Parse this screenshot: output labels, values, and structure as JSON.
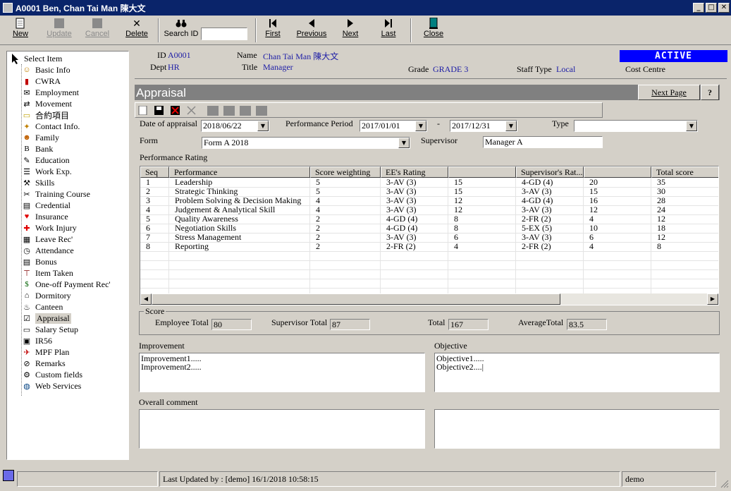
{
  "window": {
    "title": "A0001 Ben, Chan Tai Man 陳大文"
  },
  "toolbar": {
    "new": "New",
    "update": "Update",
    "cancel": "Cancel",
    "delete": "Delete",
    "search_id": "Search ID",
    "first": "First",
    "previous": "Previous",
    "next": "Next",
    "last": "Last",
    "close": "Close"
  },
  "tree": {
    "root": "Select Item",
    "items": [
      "Basic Info",
      "CWRA",
      "Employment",
      "Movement",
      "合約項目",
      "Contact Info.",
      "Family",
      "Bank",
      "Education",
      "Work Exp.",
      "Skills",
      "Training Course",
      "Credential",
      "Insurance",
      "Work Injury",
      "Leave Rec'",
      "Attendance",
      "Bonus",
      "Item Taken",
      "One-off Payment Rec'",
      "Dormitory",
      "Canteen",
      "Appraisal",
      "Salary Setup",
      "IR56",
      "MPF Plan",
      "Remarks",
      "Custom fields",
      "Web Services"
    ],
    "selected": "Appraisal"
  },
  "header": {
    "id_label": "ID",
    "id": "A0001",
    "dept_label": "Dept",
    "dept": "HR",
    "name_label": "Name",
    "name": "Chan Tai Man 陳大文",
    "title_label": "Title",
    "title": "Manager",
    "grade_label": "Grade",
    "grade": "GRADE 3",
    "stafftype_label": "Staff Type",
    "stafftype": "Local",
    "costcentre_label": "Cost Centre",
    "status": "ACTIVE"
  },
  "panel": {
    "title": "Appraisal",
    "next_page": "Next Page",
    "help": "?"
  },
  "form": {
    "date_label": "Date of appraisal",
    "date": "2018/06/22",
    "period_label": "Performance Period",
    "period_from": "2017/01/01",
    "dash": "-",
    "period_to": "2017/12/31",
    "type_label": "Type",
    "type": "",
    "form_label": "Form",
    "form": "Form A 2018",
    "supervisor_label": "Supervisor",
    "supervisor": "Manager A",
    "rating_label": "Performance Rating"
  },
  "grid": {
    "headers": [
      "Seq",
      "Performance",
      "Score weighting",
      "EE's Rating",
      "",
      "Supervisor's Rat...",
      "",
      "Total score"
    ],
    "rows": [
      [
        "1",
        "Leadership",
        "5",
        "3-AV (3)",
        "15",
        "4-GD (4)",
        "20",
        "35"
      ],
      [
        "2",
        "Strategic Thinking",
        "5",
        "3-AV (3)",
        "15",
        "3-AV (3)",
        "15",
        "30"
      ],
      [
        "3",
        "Problem Solving & Decision Making",
        "4",
        "3-AV (3)",
        "12",
        "4-GD (4)",
        "16",
        "28"
      ],
      [
        "4",
        "Judgement & Analytical Skill",
        "4",
        "3-AV (3)",
        "12",
        "3-AV (3)",
        "12",
        "24"
      ],
      [
        "5",
        "Quality Awareness",
        "2",
        "4-GD (4)",
        "8",
        "2-FR (2)",
        "4",
        "12"
      ],
      [
        "6",
        "Negotiation Skills",
        "2",
        "4-GD (4)",
        "8",
        "5-EX (5)",
        "10",
        "18"
      ],
      [
        "7",
        "Stress Management",
        "2",
        "3-AV (3)",
        "6",
        "3-AV (3)",
        "6",
        "12"
      ],
      [
        "8",
        "Reporting",
        "2",
        "2-FR (2)",
        "4",
        "2-FR (2)",
        "4",
        "8"
      ]
    ]
  },
  "score": {
    "group_label": "Score",
    "employee_total_label": "Employee Total",
    "employee_total": "80",
    "supervisor_total_label": "Supervisor Total",
    "supervisor_total": "87",
    "total_label": "Total",
    "total": "167",
    "average_label": "AverageTotal",
    "average": "83.5"
  },
  "improvement": {
    "label": "Improvement",
    "lines": [
      "Improvement1.....",
      "Improvement2....."
    ]
  },
  "objective": {
    "label": "Objective",
    "lines": [
      "Objective1.....",
      "Objective2....|"
    ]
  },
  "overall": {
    "label": "Overall comment"
  },
  "status": {
    "updated": "Last Updated by : [demo]  16/1/2018 10:58:15",
    "user": "demo"
  }
}
